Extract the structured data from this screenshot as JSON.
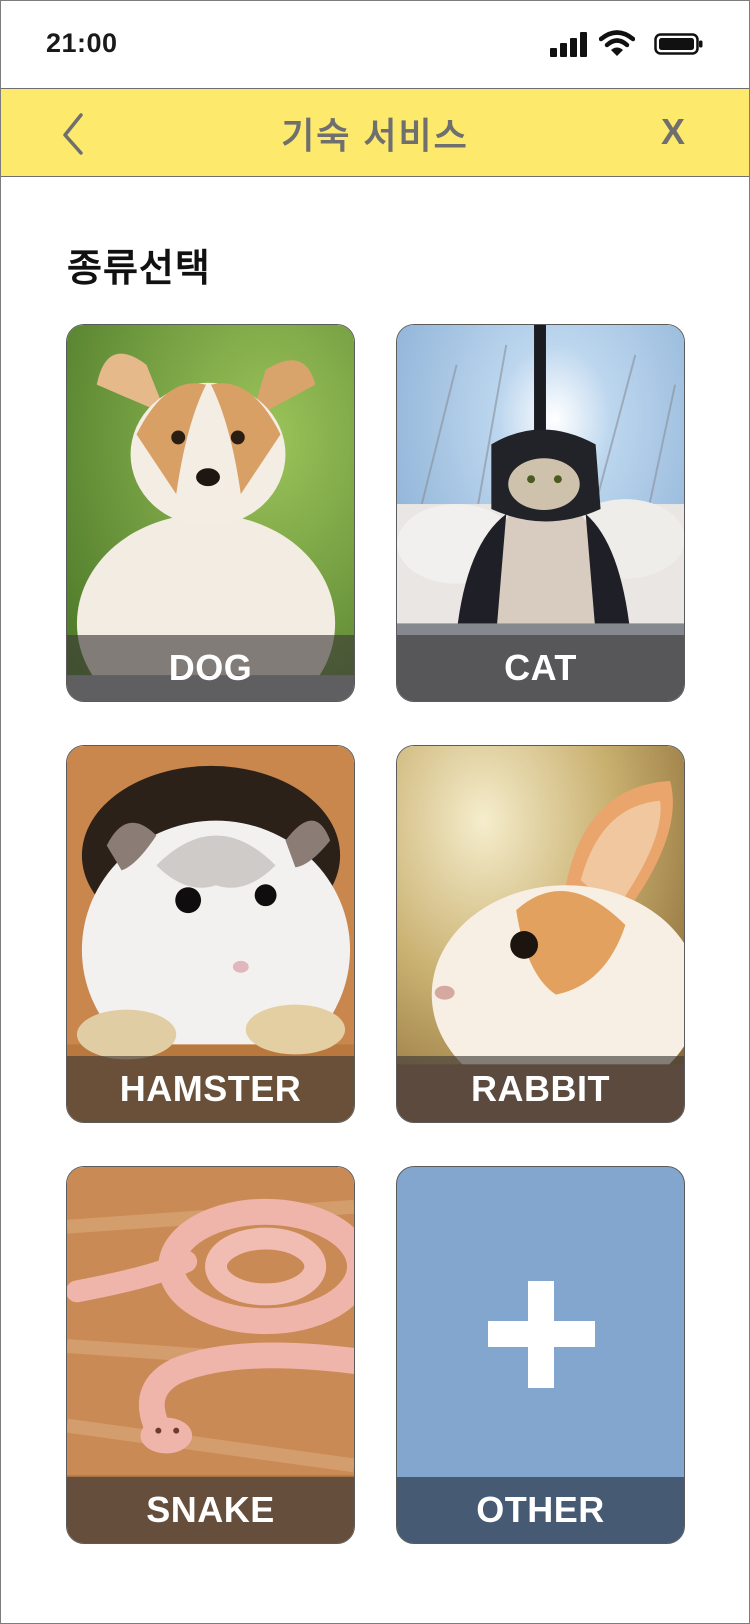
{
  "status_bar": {
    "time": "21:00",
    "icons": [
      "signal-icon",
      "wifi-icon",
      "battery-icon"
    ]
  },
  "header": {
    "back_icon": "chevron-left-icon",
    "title": "기숙 서비스",
    "close_label": "X",
    "background": "#fde96b"
  },
  "section": {
    "title": "종류선택"
  },
  "species": [
    {
      "label": "DOG",
      "image": "puppy photo"
    },
    {
      "label": "CAT",
      "image": "cat wearing helmet photo"
    },
    {
      "label": "HAMSTER",
      "image": "hamster photo"
    },
    {
      "label": "RABBIT",
      "image": "rabbit photo"
    },
    {
      "label": "SNAKE",
      "image": "pink snake photo"
    },
    {
      "label": "OTHER",
      "icon": "plus-icon",
      "background": "#82a6cd"
    }
  ]
}
